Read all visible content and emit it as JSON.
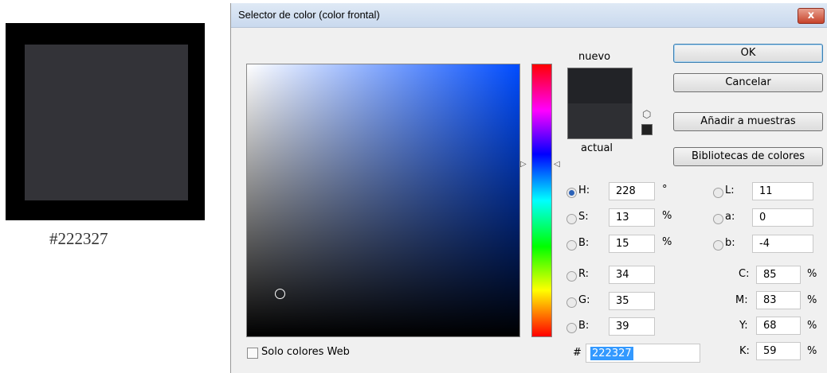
{
  "swatch": {
    "hex_label": "#222327"
  },
  "dialog": {
    "title": "Selector de color (color frontal)",
    "close_label": "x",
    "preview": {
      "new_label": "nuevo",
      "current_label": "actual"
    },
    "buttons": {
      "ok": "OK",
      "cancel": "Cancelar",
      "add_to_swatches": "Añadir a muestras",
      "color_libraries": "Bibliotecas de colores"
    },
    "hsb": {
      "h": {
        "label": "H:",
        "value": "228",
        "unit": "°"
      },
      "s": {
        "label": "S:",
        "value": "13",
        "unit": "%"
      },
      "b": {
        "label": "B:",
        "value": "15",
        "unit": "%"
      }
    },
    "rgb": {
      "r": {
        "label": "R:",
        "value": "34"
      },
      "g": {
        "label": "G:",
        "value": "35"
      },
      "b": {
        "label": "B:",
        "value": "39"
      }
    },
    "lab": {
      "l": {
        "label": "L:",
        "value": "11"
      },
      "a": {
        "label": "a:",
        "value": "0"
      },
      "b": {
        "label": "b:",
        "value": "-4"
      }
    },
    "cmyk": {
      "c": {
        "label": "C:",
        "value": "85",
        "unit": "%"
      },
      "m": {
        "label": "M:",
        "value": "83",
        "unit": "%"
      },
      "y": {
        "label": "Y:",
        "value": "68",
        "unit": "%"
      },
      "k": {
        "label": "K:",
        "value": "59",
        "unit": "%"
      }
    },
    "hex": {
      "prefix": "#",
      "value": "222327"
    },
    "web_only": {
      "label": "Solo colores Web",
      "checked": false
    },
    "colors": {
      "new": "#222327",
      "current": "#2e2f33",
      "accent": "#3399ff",
      "hue_bar_selected": "H"
    }
  }
}
